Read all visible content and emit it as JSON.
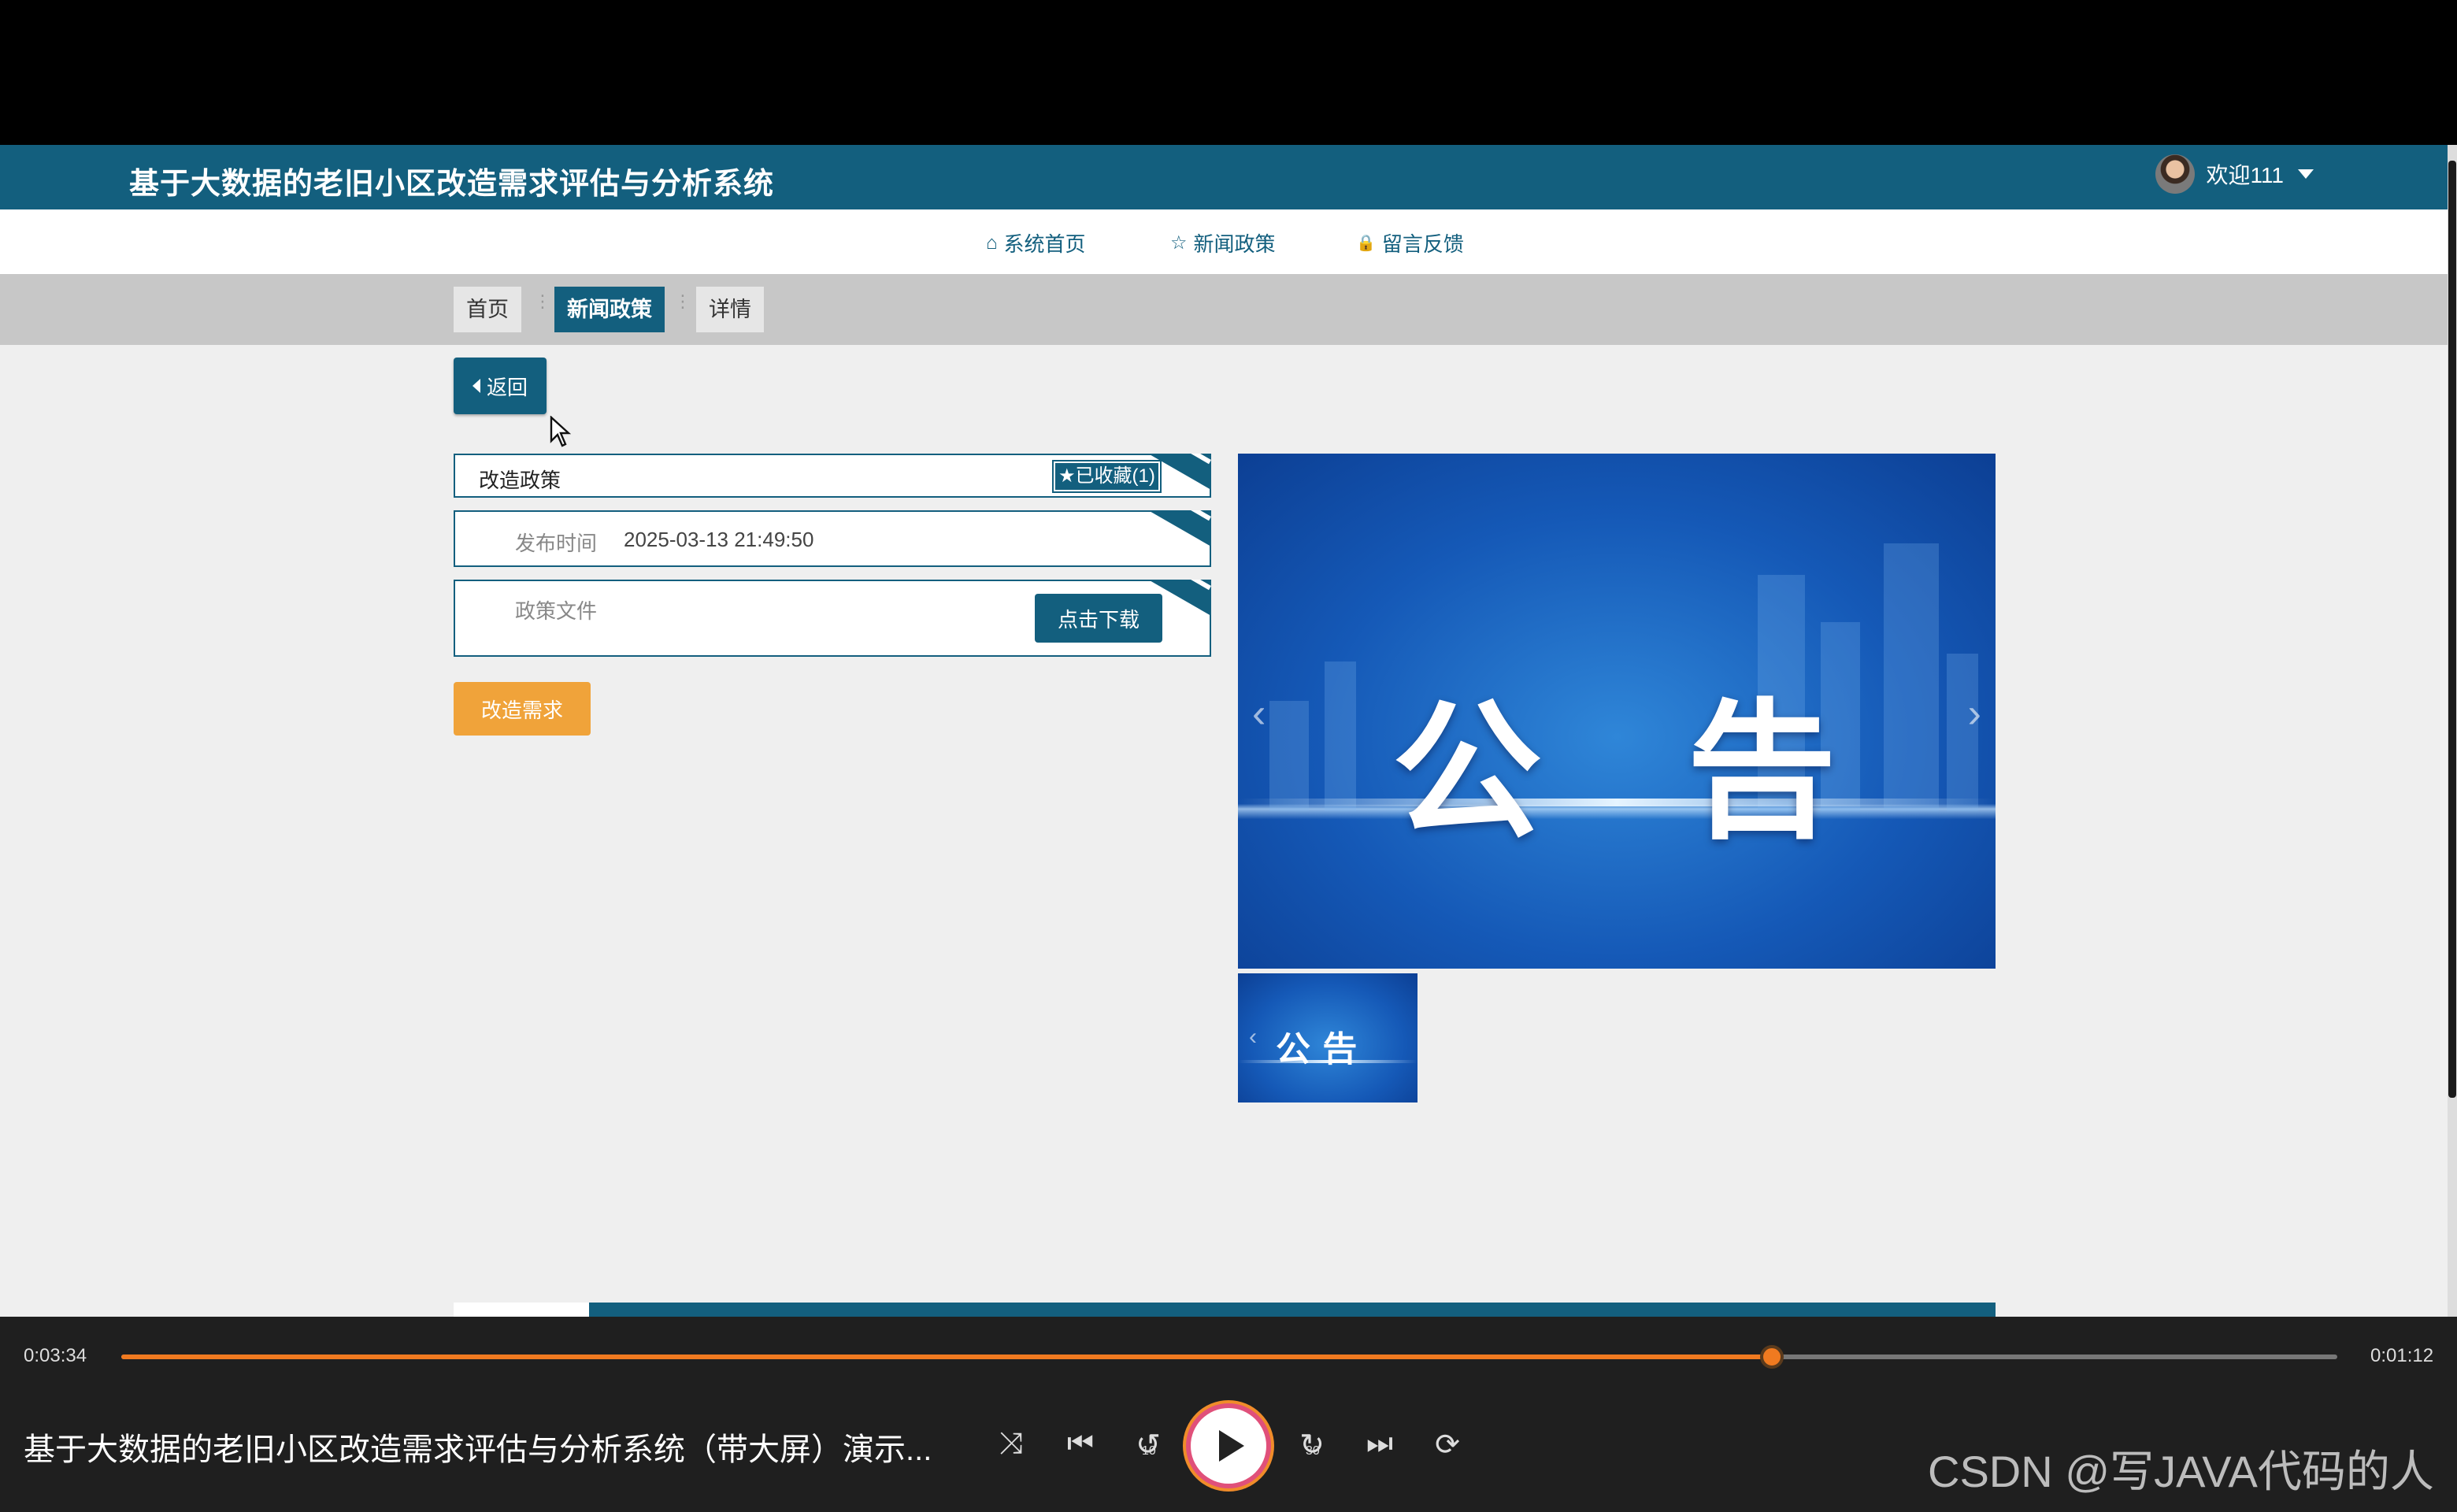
{
  "site": {
    "title": "基于大数据的老旧小区改造需求评估与分析系统",
    "user_greeting": "欢迎111",
    "nav": [
      {
        "label": "系统首页",
        "icon": "⌂"
      },
      {
        "label": "新闻政策",
        "icon": "☆"
      },
      {
        "label": "留言反馈",
        "icon": "🔒"
      }
    ],
    "breadcrumb": [
      "首页",
      "新闻政策",
      "详情"
    ],
    "back_label": "返回",
    "detail": {
      "title_value": "改造政策",
      "favorite_label": "★已收藏(1)",
      "publish_label": "发布时间",
      "publish_value": "2025-03-13 21:49:50",
      "file_label": "政策文件",
      "download_label": "点击下载"
    },
    "reform_label": "改造需求",
    "banner": {
      "char1": "公",
      "char2": "告",
      "prev": "‹",
      "next": "›"
    },
    "thumb": {
      "text": "公 告",
      "prev": "‹"
    }
  },
  "player": {
    "elapsed": "0:03:34",
    "remaining": "0:01:12",
    "progress": 0.745,
    "video_title": "基于大数据的老旧小区改造需求评估与分析系统（带大屏）演示...",
    "controls": {
      "shuffle": "⤨",
      "prev": "⏮",
      "rewind": "↺",
      "forward": "↻",
      "next": "⏭",
      "repeat": "⟳"
    },
    "rewind_num": "10",
    "forward_num": "30",
    "watermark": "CSDN @写JAVA代码的人"
  },
  "colors": {
    "brand": "#135f7e",
    "accent_orange": "#f0a33a",
    "progress": "#f07a20"
  }
}
